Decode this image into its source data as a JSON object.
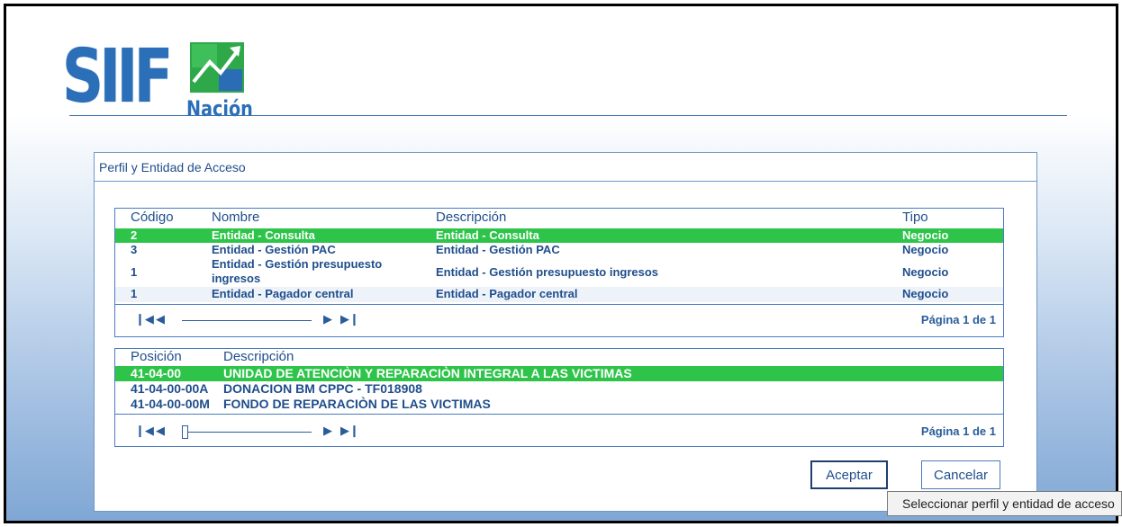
{
  "logo": {
    "main": "SIIF",
    "sub": "Nación"
  },
  "dialog": {
    "title": "Perfil y Entidad de Acceso",
    "profiles": {
      "headers": {
        "code": "Código",
        "name": "Nombre",
        "description": "Descripción",
        "type": "Tipo"
      },
      "rows": [
        {
          "code": "2",
          "name": "Entidad - Consulta",
          "description": "Entidad - Consulta",
          "type": "Negocio",
          "selected": true
        },
        {
          "code": "3",
          "name": "Entidad - Gestión PAC",
          "description": "Entidad - Gestión PAC",
          "type": "Negocio",
          "selected": false
        },
        {
          "code": "1",
          "name": "Entidad - Gestión presupuesto ingresos",
          "description": "Entidad - Gestión presupuesto ingresos",
          "type": "Negocio",
          "selected": false
        },
        {
          "code": "1",
          "name": "Entidad - Pagador central",
          "description": "Entidad - Pagador central",
          "type": "Negocio",
          "selected": false
        }
      ],
      "pager_label": "Página 1 de 1"
    },
    "positions": {
      "headers": {
        "position": "Posición",
        "description": "Descripción"
      },
      "rows": [
        {
          "position": "41-04-00",
          "description": "UNIDAD DE ATENCIÒN Y REPARACIÒN INTEGRAL A LAS VICTIMAS",
          "selected": true
        },
        {
          "position": "41-04-00-00A",
          "description": "DONACION BM CPPC - TF018908",
          "selected": false
        },
        {
          "position": "41-04-00-00M",
          "description": "FONDO DE REPARACIÒN DE LAS VICTIMAS",
          "selected": false
        }
      ],
      "pager_label": "Página 1 de 1"
    },
    "buttons": {
      "accept": "Aceptar",
      "cancel": "Cancelar"
    }
  },
  "tooltip": "Seleccionar perfil y entidad de acceso",
  "colors": {
    "accent": "#1f4e8c",
    "selected_row": "#2ec44a",
    "border": "#4a7bbf"
  }
}
